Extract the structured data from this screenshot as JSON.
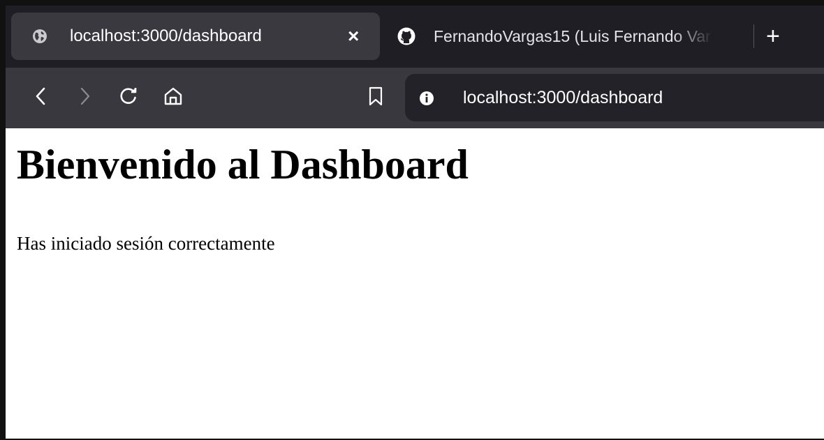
{
  "browser": {
    "tabs": [
      {
        "title": "localhost:3000/dashboard",
        "icon": "globe-icon",
        "active": true,
        "close_symbol": "×"
      },
      {
        "title": "FernandoVargas15 (Luis Fernando Var",
        "icon": "github-icon",
        "active": false
      }
    ],
    "new_tab_symbol": "+",
    "toolbar": {
      "back_icon": "chevron-left-icon",
      "forward_icon": "chevron-right-icon",
      "reload_icon": "reload-icon",
      "home_icon": "home-icon",
      "bookmark_icon": "bookmark-icon"
    },
    "address_bar": {
      "url": "localhost:3000/dashboard",
      "site_info_icon": "info-icon"
    },
    "colors": {
      "tabstrip": "#1f1e25",
      "active_tab": "#3a3940",
      "toolbar": "#39383e",
      "address_bar": "#232229"
    }
  },
  "page": {
    "heading": "Bienvenido al Dashboard",
    "message": "Has iniciado sesión correctamente"
  }
}
